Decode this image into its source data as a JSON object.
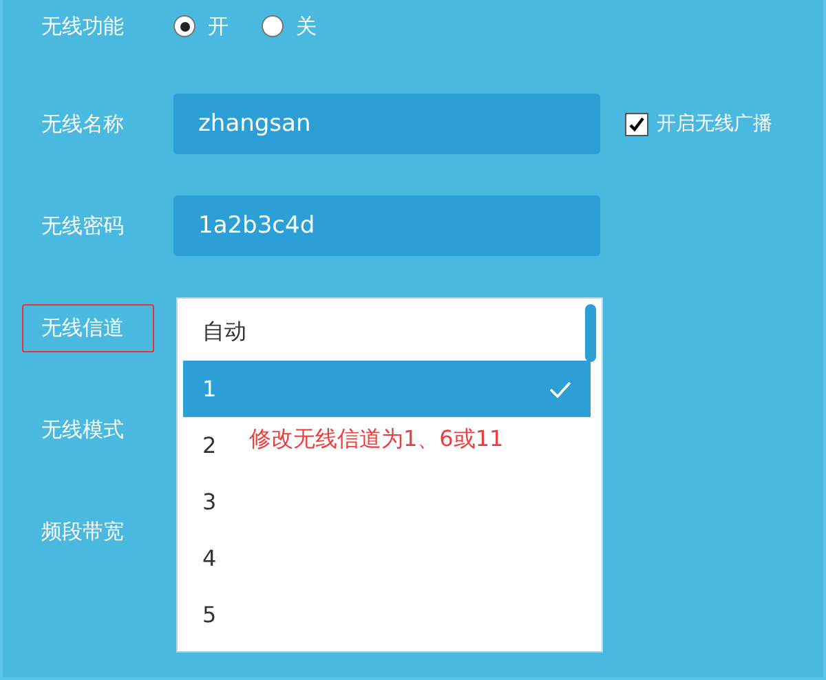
{
  "settings": [
    {
      "kind": "radio",
      "label": "无线功能",
      "options": [
        {
          "label": "开",
          "selected": true
        },
        {
          "label": "关",
          "selected": false
        }
      ]
    },
    {
      "kind": "text",
      "label": "无线名称",
      "value": "zhangsan",
      "checkbox": {
        "label": "开启无线广播",
        "checked": true
      }
    },
    {
      "kind": "text",
      "label": "无线密码",
      "value": "1a2b3c4d"
    },
    {
      "kind": "select",
      "label": "无线信道",
      "highlighted": true,
      "dropdown": {
        "options": [
          {
            "label": "自动",
            "selected": false
          },
          {
            "label": "1",
            "selected": true
          },
          {
            "label": "2",
            "selected": false
          },
          {
            "label": "3",
            "selected": false
          },
          {
            "label": "4",
            "selected": false
          },
          {
            "label": "5",
            "selected": false
          }
        ],
        "annotation": "修改无线信道为1、6或11"
      }
    },
    {
      "kind": "label",
      "label": "无线模式"
    },
    {
      "kind": "label",
      "label": "频段带宽"
    }
  ]
}
